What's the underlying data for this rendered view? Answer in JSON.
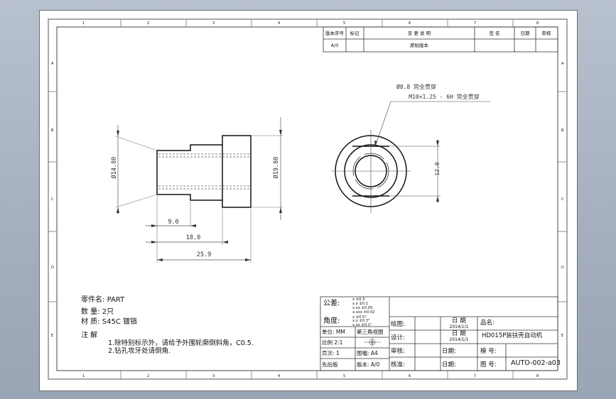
{
  "revision_table": {
    "headers": [
      "版本序号",
      "标记",
      "变  更  说  明",
      "签  名",
      "日期",
      "审核"
    ],
    "row": {
      "version": "A/0",
      "description": "原始版本"
    }
  },
  "zones": {
    "columns": [
      "1",
      "2",
      "3",
      "4",
      "5",
      "6",
      "7",
      "8"
    ],
    "rows": [
      "A",
      "B",
      "C",
      "D",
      "E"
    ]
  },
  "front_view": {
    "dia_left": "Ø14.80",
    "dia_right": "Ø19.80",
    "dim_9": "9.0",
    "dim_18": "18.0",
    "dim_259": "25.9"
  },
  "side_view": {
    "callout_1": "Ø8.8 完全贯穿",
    "callout_2": "M10×1.25 - 6H 完全贯穿",
    "dim_12": "12.0"
  },
  "part_info": {
    "part_name_label": "零件名:",
    "part_name": "PART",
    "qty_label": "数  量:",
    "qty": "2只",
    "material_label": "材  质:",
    "material": "S45C 镀铬"
  },
  "notes": {
    "title": "注  解",
    "line1": "1.除特别标示外，请给予外围轮廓倒斜角，C0.5.",
    "line2": "2.钻孔攻牙处请倒角."
  },
  "title_block": {
    "tolerance_label": "公差:",
    "angle_label": "角度:",
    "tol_values": [
      "x  ±0.3",
      "x.x  ±0.1",
      "x.xx  ±0.05",
      "x.xxx  ±0.02",
      "x  ±0.5°",
      "x.x  ±0.3°",
      "x.xx  ±0.1°"
    ],
    "unit_label": "单位: MM",
    "scale_label": "比例  2:1",
    "page_label": "页次:  1",
    "drawing_label": "图幅: A4",
    "projection_label": "第三角视图",
    "first_publish": "先后版",
    "version_label": "版本: A/0",
    "drawn_label": "绘图:",
    "design_label": "设计:",
    "review_label": "审核:",
    "approve_label": "核准:",
    "date_label": "日  期",
    "date1": "2014/1/1",
    "date2": "2014/1/1",
    "date3_label": "日期:",
    "date4_label": "日期:",
    "product_label": "品名:",
    "product_name": "HD015P装扶壳自动机",
    "model_label": "模  号:",
    "drawing_no_label": "图  号:",
    "drawing_no": "AUTO-002-a03"
  }
}
